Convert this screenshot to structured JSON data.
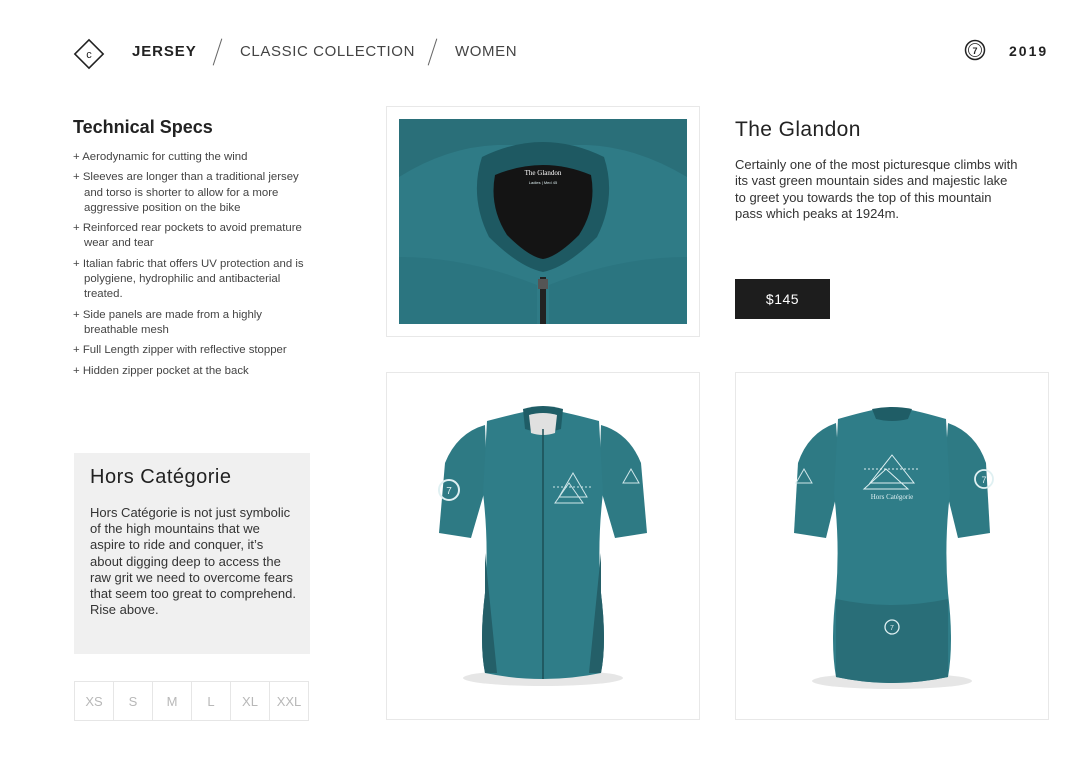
{
  "header": {
    "breadcrumb": [
      "JERSEY",
      "CLASSIC COLLECTION",
      "WOMEN"
    ],
    "badge_icon": "seven-circle-icon",
    "year": "2019",
    "logo_icon": "diamond-c-logo-icon"
  },
  "specs": {
    "title": "Technical Specs",
    "items": [
      "+ Aerodynamic for cutting the wind",
      "+ Sleeves are longer than a traditional jersey and torso is shorter to allow for a more aggressive position on the bike",
      "+ Reinforced rear pockets to avoid premature wear and tear",
      "+ Italian fabric that offers UV protection and is polygiene, hydrophilic and antibacterial treated.",
      "+ Side panels are made from a highly breathable mesh",
      "+ Full Length zipper with reflective stopper",
      "+ Hidden zipper pocket at the back"
    ]
  },
  "hors_categorie": {
    "title": "Hors Catégorie",
    "text": "Hors Catégorie is not just symbolic of the high mountains that we aspire to ride and conquer, it’s about digging deep to access the raw grit we need to overcome fears that seem too great to comprehend. Rise above."
  },
  "sizes": [
    "XS",
    "S",
    "M",
    "L",
    "XL",
    "XXL"
  ],
  "product": {
    "title": "The Glandon",
    "description": "Certainly one of the most picturesque climbs with its vast green mountain sides and majestic lake to greet you towards the top of this mountain pass which peaks at 1924m.",
    "price": "$145"
  },
  "images": {
    "collar_label_line1": "The Glandon",
    "collar_label_line2": "Ladies | Med 45",
    "back_print": "Hors Catégorie"
  },
  "colors": {
    "jersey_teal": "#2e7a84",
    "jersey_dark": "#1f5d66",
    "price_bg": "#1d1d1d",
    "panel_bg": "#f0f0f0"
  }
}
